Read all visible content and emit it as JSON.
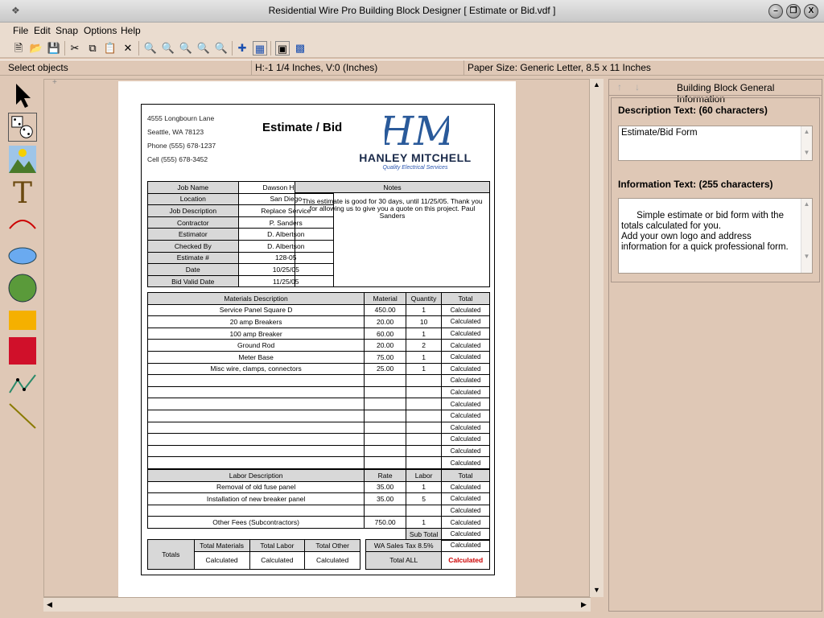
{
  "window": {
    "title": "Residential Wire Pro Building Block Designer [ Estimate or Bid.vdf ]"
  },
  "menu": [
    "File",
    "Edit",
    "Snap",
    "Options",
    "Help"
  ],
  "status": {
    "mode": "Select objects",
    "position": "H:-1 1/4 Inches, V:0 (Inches)",
    "paper": "Paper Size: Generic Letter, 8.5 x 11 Inches"
  },
  "form": {
    "title": "Estimate / Bid",
    "address": [
      "4555 Longbourn Lane",
      "Seattle, WA 78123",
      "Phone (555) 678-1237",
      "Cell (555) 678-3452"
    ],
    "logo_company": "HANLEY MITCHELL",
    "logo_tagline": "Quality Electrical Services",
    "info": [
      [
        "Job Name",
        "Dawson House"
      ],
      [
        "Location",
        "San Diego"
      ],
      [
        "Job Description",
        "Replace Service"
      ],
      [
        "Contractor",
        "P. Sanders"
      ],
      [
        "Estimator",
        "D. Albertson"
      ],
      [
        "Checked By",
        "D. Albertson"
      ],
      [
        "Estimate #",
        "128-05"
      ],
      [
        "Date",
        "10/25/05"
      ],
      [
        "Bid Valid Date",
        "11/25/05"
      ]
    ],
    "notes_header": "Notes",
    "notes_text": "This estimate is good for 30 days, until 11/25/05. Thank you for allowing us to give you a quote on this project. Paul Sanders",
    "materials_headers": [
      "Materials Description",
      "Material",
      "Quantity",
      "Total"
    ],
    "materials": [
      [
        "Service Panel Square D",
        "450.00",
        "1",
        "Calculated"
      ],
      [
        "20 amp Breakers",
        "20.00",
        "10",
        "Calculated"
      ],
      [
        "100 amp Breaker",
        "60.00",
        "1",
        "Calculated"
      ],
      [
        "Ground Rod",
        "20.00",
        "2",
        "Calculated"
      ],
      [
        "Meter Base",
        "75.00",
        "1",
        "Calculated"
      ],
      [
        "Misc wire, clamps, connectors",
        "25.00",
        "1",
        "Calculated"
      ],
      [
        "",
        "",
        "",
        "Calculated"
      ],
      [
        "",
        "",
        "",
        "Calculated"
      ],
      [
        "",
        "",
        "",
        "Calculated"
      ],
      [
        "",
        "",
        "",
        "Calculated"
      ],
      [
        "",
        "",
        "",
        "Calculated"
      ],
      [
        "",
        "",
        "",
        "Calculated"
      ],
      [
        "",
        "",
        "",
        "Calculated"
      ],
      [
        "",
        "",
        "",
        "Calculated"
      ]
    ],
    "labor_headers": [
      "Labor Description",
      "Rate",
      "Labor",
      "Total"
    ],
    "labor": [
      [
        "Removal of old fuse panel",
        "35.00",
        "1",
        "Calculated"
      ],
      [
        "Installation of new breaker panel",
        "35.00",
        "5",
        "Calculated"
      ],
      [
        "",
        "",
        "",
        "Calculated"
      ],
      [
        "Other Fees (Subcontractors)",
        "750.00",
        "1",
        "Calculated"
      ]
    ],
    "subtotal_label": "Sub Total",
    "subtotal_value": "Calculated",
    "totals_label": "Totals",
    "totals_headers": [
      "Total Materials",
      "Total Labor",
      "Total Other"
    ],
    "totals_values": [
      "Calculated",
      "Calculated",
      "Calculated"
    ],
    "tax_label": "WA Sales Tax 8.5%",
    "tax_value": "Calculated",
    "total_all_label": "Total ALL",
    "total_all_value": "Calculated"
  },
  "panel": {
    "title": "Building Block General Information",
    "desc_label": "Description Text: (60 characters)",
    "desc_value": "Estimate/Bid Form",
    "info_label": "Information Text: (255 characters)",
    "info_value": "Simple estimate or bid form with the totals calculated for you.\nAdd your own logo and address information for a quick professional form."
  }
}
